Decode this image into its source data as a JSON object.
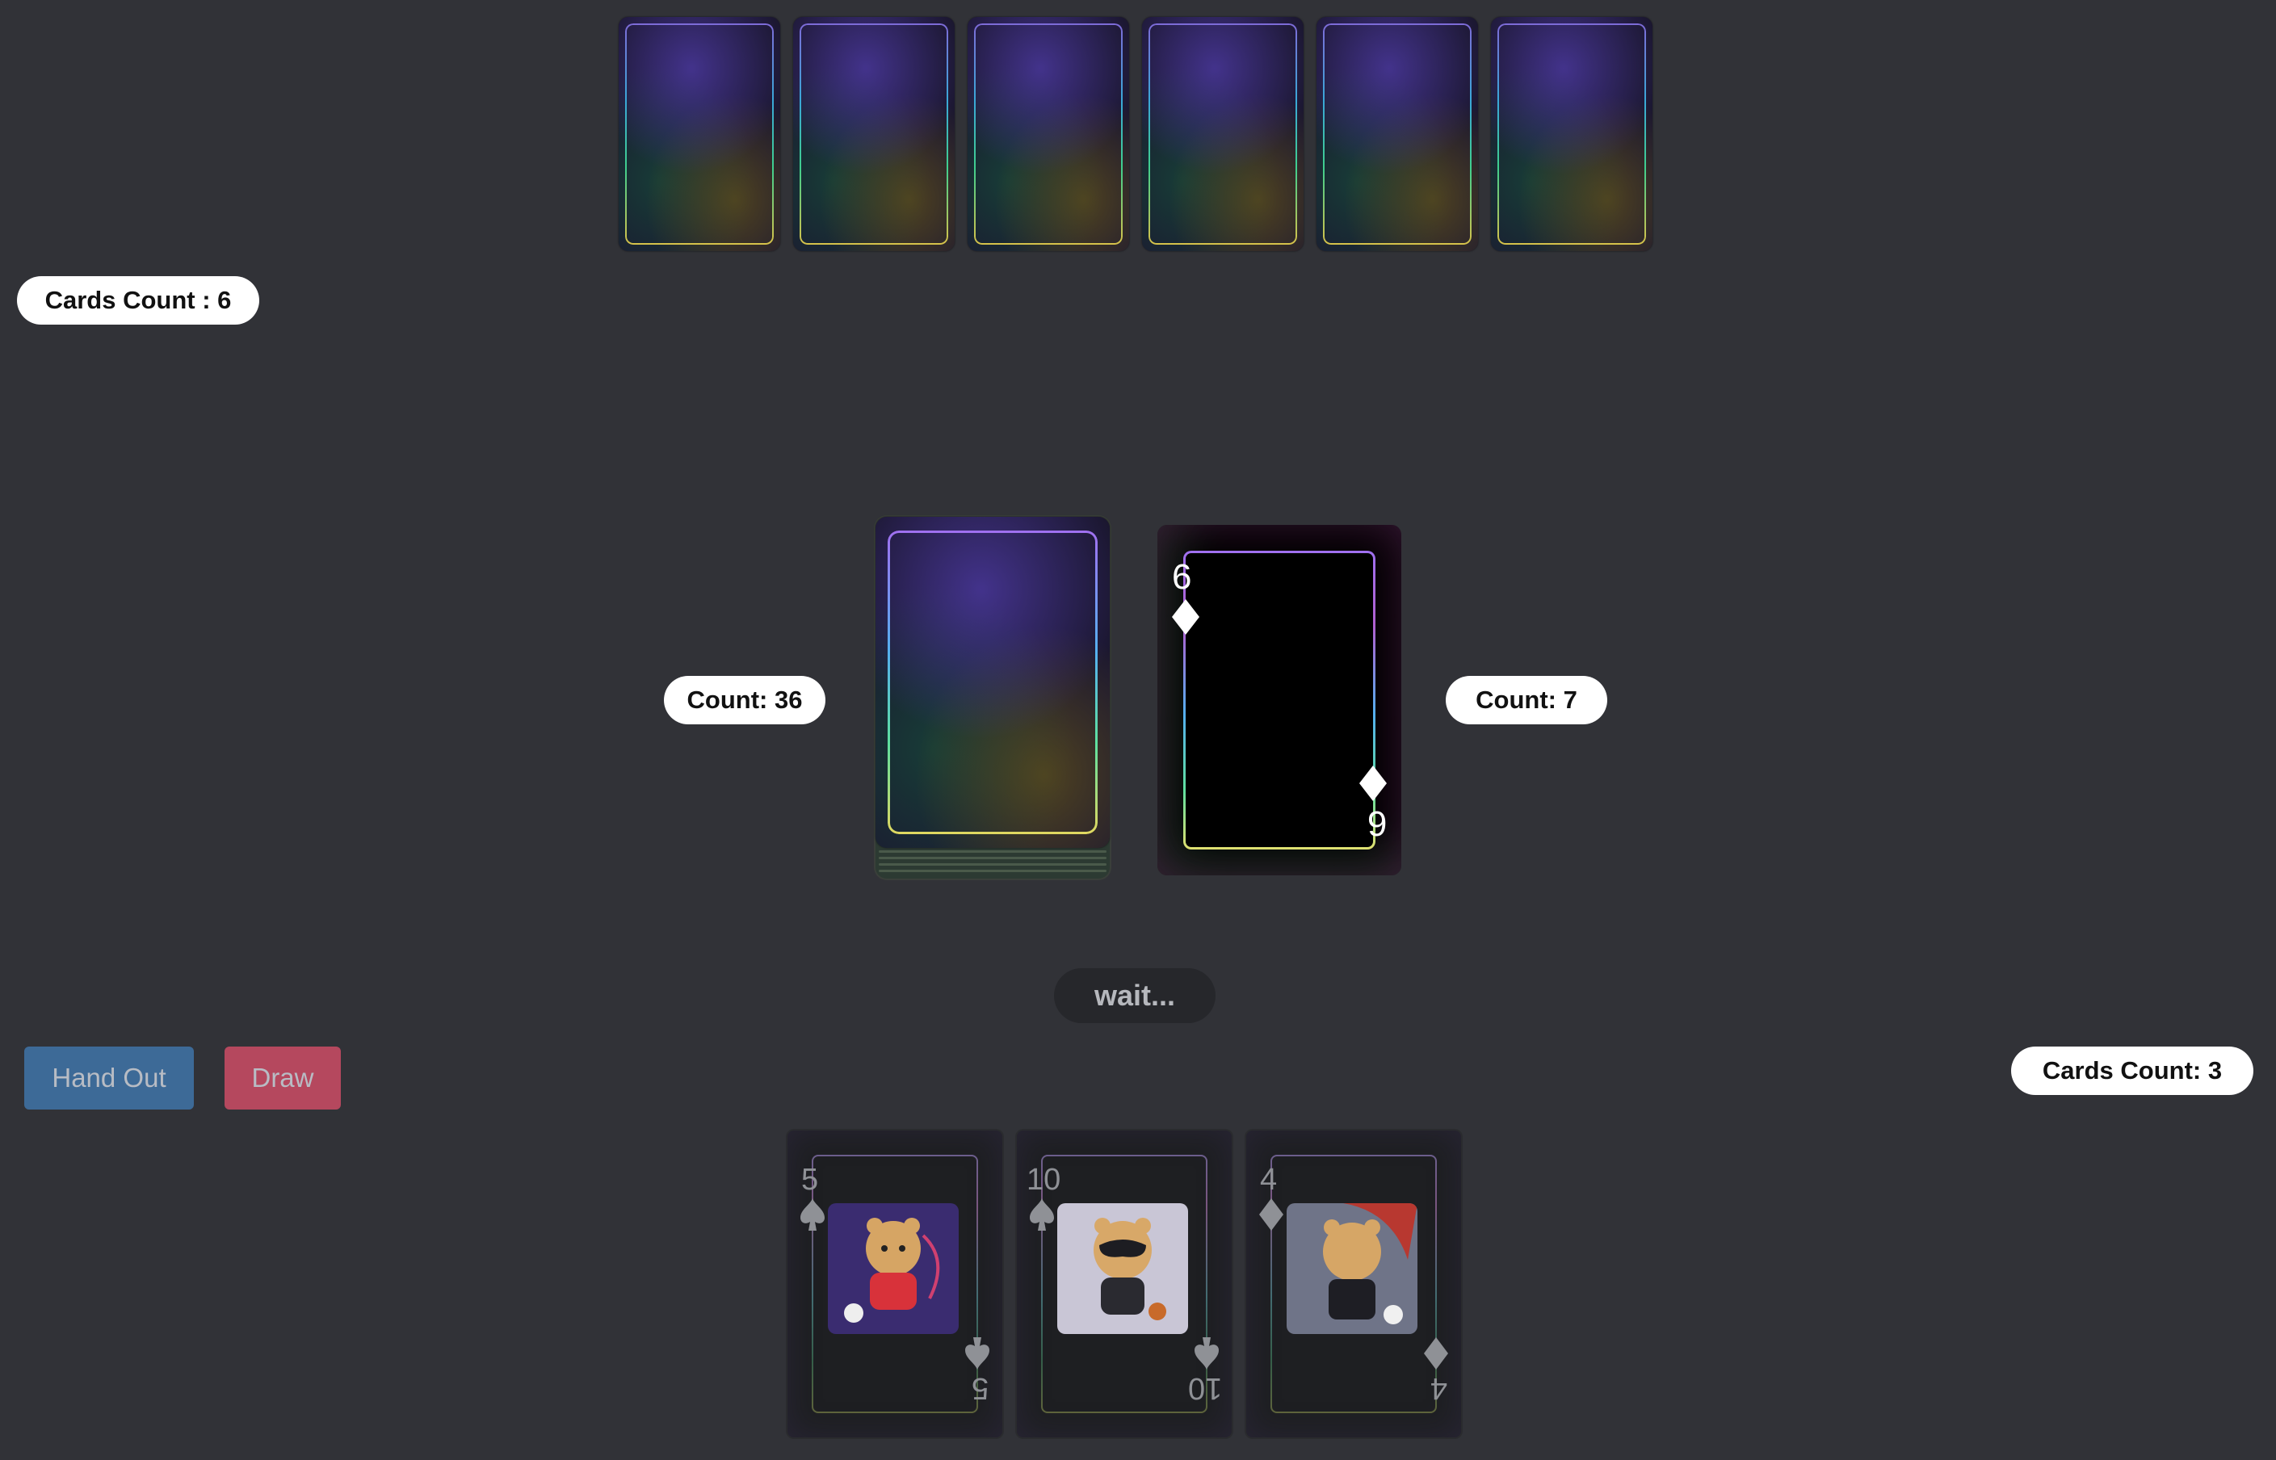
{
  "opponent": {
    "cards_count_label": "Cards Count : 6",
    "hand_size": 6
  },
  "deck": {
    "count_label": "Count: 36"
  },
  "discard": {
    "count_label": "Count: 7",
    "top_card": {
      "rank": "6",
      "suit": "diamond"
    }
  },
  "status": {
    "wait_label": "wait..."
  },
  "controls": {
    "hand_out_label": "Hand Out",
    "draw_label": "Draw",
    "hand_out_color": "#3d6a97",
    "draw_color": "#b5485e"
  },
  "player": {
    "cards_count_label": "Cards Count: 3",
    "hand": [
      {
        "rank": "5",
        "suit": "spade",
        "art": "tiger-red-shirt"
      },
      {
        "rank": "10",
        "suit": "spade",
        "art": "tiger-masked"
      },
      {
        "rank": "4",
        "suit": "diamond",
        "art": "tiger-caped"
      }
    ]
  },
  "colors": {
    "background": "#313237",
    "pill_background": "#ffffff"
  }
}
